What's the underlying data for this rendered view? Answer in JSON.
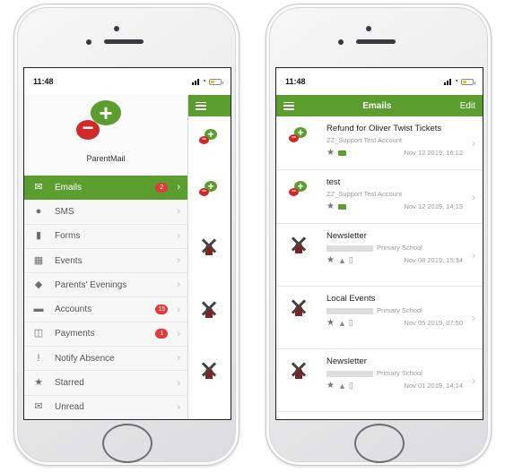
{
  "left_phone": {
    "status_time": "11:48",
    "logo_text": "ParentMail",
    "menu": [
      {
        "icon": "envelope-icon",
        "label": "Emails",
        "badge": "2",
        "active": true
      },
      {
        "icon": "chat-bubble-icon",
        "label": "SMS",
        "badge": "",
        "active": false
      },
      {
        "icon": "document-icon",
        "label": "Forms",
        "badge": "",
        "active": false
      },
      {
        "icon": "calendar-icon",
        "label": "Events",
        "badge": "",
        "active": false
      },
      {
        "icon": "tag-icon",
        "label": "Parents' Evenings",
        "badge": "",
        "active": false
      },
      {
        "icon": "wallet-icon",
        "label": "Accounts",
        "badge": "15",
        "active": false
      },
      {
        "icon": "basket-icon",
        "label": "Payments",
        "badge": "1",
        "active": false
      },
      {
        "icon": "alert-icon",
        "label": "Notify Absence",
        "badge": "",
        "active": false
      },
      {
        "icon": "star-icon",
        "label": "Starred",
        "badge": "",
        "active": false
      },
      {
        "icon": "open-envelope-icon",
        "label": "Unread",
        "badge": "",
        "active": false
      }
    ]
  },
  "right_phone": {
    "status_time": "11:48",
    "header": {
      "title": "Emails",
      "edit_label": "Edit"
    },
    "emails": [
      {
        "avatar": "parentmail-logo-icon",
        "subject": "Refund for Oliver Twist Tickets",
        "sender": "ZZ_Support Test Account",
        "sender_suffix": "",
        "date": "Nov 12 2019, 16:12",
        "attachment_icons": false
      },
      {
        "avatar": "parentmail-logo-icon",
        "subject": "test",
        "sender": "ZZ_Support Test Account",
        "sender_suffix": "",
        "date": "Nov 12 2019, 14:13",
        "attachment_icons": false
      },
      {
        "avatar": "windmill-school-icon",
        "subject": "Newsletter",
        "sender": "",
        "sender_suffix": "Primary School",
        "date": "Nov 08 2019, 15:34",
        "attachment_icons": true
      },
      {
        "avatar": "windmill-school-icon",
        "subject": "Local Events",
        "sender": "",
        "sender_suffix": "Primary School",
        "date": "Nov 05 2019, 07:50",
        "attachment_icons": true
      },
      {
        "avatar": "windmill-school-icon",
        "subject": "Newsletter",
        "sender": "",
        "sender_suffix": "Primary School",
        "date": "Nov 01 2019, 14:14",
        "attachment_icons": true
      }
    ]
  },
  "colors": {
    "brand_green": "#5c9d2f",
    "badge_red": "#e23b3b",
    "logo_red": "#cf2a27"
  }
}
